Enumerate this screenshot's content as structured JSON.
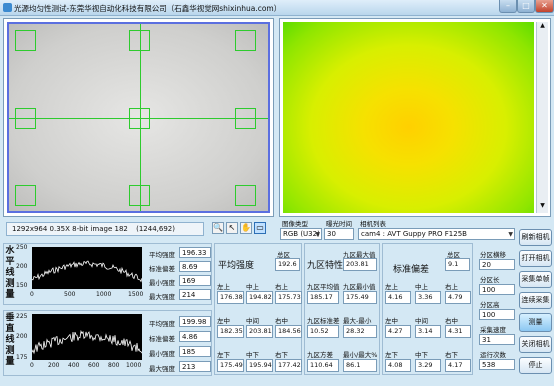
{
  "window": {
    "title": "光源均匀性测试-东莞华视自动化科技有限公司（石鑫华视觉网shixinhua.com）"
  },
  "status": {
    "image_info": "1292x964 0.35X 8-bit image 182",
    "coords": "(1244,692)"
  },
  "controls": {
    "image_type_label": "图像类型",
    "image_type_value": "RGB (U32)",
    "exposure_label": "曝光时间",
    "exposure_value": "30",
    "camera_list_label": "相机列表",
    "camera_value": "cam4 : AVT Guppy PRO F125B"
  },
  "buttons": {
    "refresh_camera": "刷新相机",
    "open_camera": "打开相机",
    "single_capture": "采集单帧",
    "continuous_capture": "连续采集",
    "measure": "测量",
    "close_camera": "关闭相机",
    "stop": "停止"
  },
  "right_fields": {
    "h_points_label": "分区横移",
    "h_points_value": "20",
    "zone_length_label": "分区长",
    "zone_length_value": "100",
    "zone_height_label": "分区高",
    "zone_height_value": "100",
    "capture_speed_label": "采集速度",
    "capture_speed_value": "31",
    "run_count_label": "运行次数",
    "run_count_value": "538"
  },
  "horizontal": {
    "label": "水平线测量",
    "stats": [
      {
        "label": "平均强度",
        "value": "196.33"
      },
      {
        "label": "标准偏差",
        "value": "8.69"
      },
      {
        "label": "最小强度",
        "value": "169"
      },
      {
        "label": "最大强度",
        "value": "214"
      }
    ],
    "y_ticks": [
      "250",
      "200",
      "150"
    ],
    "x_ticks": [
      "0",
      "500",
      "1000",
      "1500"
    ]
  },
  "vertical": {
    "label": "垂直线测量",
    "stats": [
      {
        "label": "平均强度",
        "value": "199.98"
      },
      {
        "label": "标准偏差",
        "value": "4.86"
      },
      {
        "label": "最小强度",
        "value": "185"
      },
      {
        "label": "最大强度",
        "value": "213"
      }
    ],
    "y_ticks": [
      "225",
      "200",
      "175"
    ],
    "x_ticks": [
      "0",
      "200",
      "400",
      "600",
      "800",
      "1000"
    ]
  },
  "intensity": {
    "title": "平均强度",
    "total_label": "总区",
    "total_value": "192.6",
    "row_labels": [
      [
        "左上",
        "中上",
        "右上"
      ],
      [
        "左中",
        "中间",
        "右中"
      ],
      [
        "左下",
        "中下",
        "右下"
      ]
    ],
    "values": [
      [
        "176.38",
        "194.82",
        "175.73"
      ],
      [
        "182.35",
        "203.81",
        "184.56"
      ],
      [
        "175.49",
        "195.94",
        "177.42"
      ]
    ]
  },
  "nine": {
    "title": "九区特性",
    "max_label": "九区最大值",
    "max_value": "203.81",
    "avg_label": "九区平均值",
    "avg_value": "185.17",
    "min_label": "九区最小值",
    "min_value": "175.49",
    "std_label": "九区标准差",
    "std_value": "10.52",
    "maxmin_label": "最大-最小",
    "maxmin_value": "28.32",
    "var_label": "九区方差",
    "var_value": "110.64",
    "ratio_label": "最小/最大%",
    "ratio_value": "86.1"
  },
  "stddev": {
    "title": "标准偏差",
    "total_label": "总区",
    "total_value": "9.1",
    "row_labels": [
      [
        "左上",
        "中上",
        "右上"
      ],
      [
        "左中",
        "中间",
        "右中"
      ],
      [
        "左下",
        "中下",
        "右下"
      ]
    ],
    "values": [
      [
        "4.16",
        "3.36",
        "4.79"
      ],
      [
        "4.27",
        "3.14",
        "4.31"
      ],
      [
        "4.08",
        "3.29",
        "4.17"
      ]
    ]
  }
}
